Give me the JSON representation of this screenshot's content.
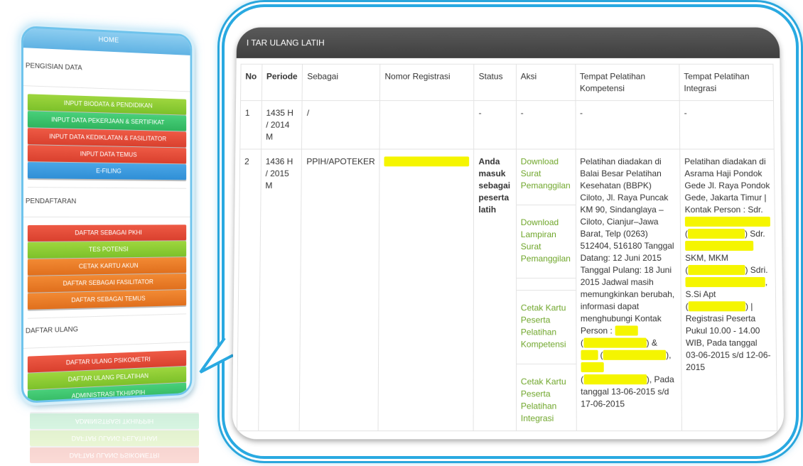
{
  "menu": {
    "home": "HOME",
    "sections": [
      {
        "title": "PENGISIAN DATA",
        "items": [
          {
            "label": "INPUT BIODATA & PENDIDIKAN",
            "color": "green"
          },
          {
            "label": "INPUT DATA PEKERJAAN & SERTIFIKAT",
            "color": "green2"
          },
          {
            "label": "INPUT DATA KEDIKLATAN & FASILITATOR",
            "color": "red"
          },
          {
            "label": "INPUT DATA TEMUS",
            "color": "red"
          },
          {
            "label": "E-FILING",
            "color": "blue"
          }
        ]
      },
      {
        "title": "PENDAFTARAN",
        "items": [
          {
            "label": "DAFTAR SEBAGAI PKHI",
            "color": "red"
          },
          {
            "label": "TES POTENSI",
            "color": "green"
          },
          {
            "label": "CETAK KARTU AKUN",
            "color": "orange"
          },
          {
            "label": "DAFTAR SEBAGAI FASILITATOR",
            "color": "orange"
          },
          {
            "label": "DAFTAR SEBAGAI TEMUS",
            "color": "orange"
          }
        ]
      },
      {
        "title": "DAFTAR ULANG",
        "items": [
          {
            "label": "DAFTAR ULANG PSIKOMETRI",
            "color": "red"
          },
          {
            "label": "DAFTAR ULANG PELATIHAN",
            "color": "green"
          },
          {
            "label": "ADMINISTRASI TKHI/PPIH",
            "color": "green2"
          }
        ]
      }
    ]
  },
  "colors": {
    "green": "#8ccd34",
    "green2": "#3cc36c",
    "red": "#e24a37",
    "blue": "#3c9ade",
    "orange": "#e97c27",
    "header_bg": "#4a4a4a",
    "link": "#6fa62a",
    "bubble_border": "#29a9e1"
  },
  "window": {
    "title": "I TAR ULANG LATIH"
  },
  "table": {
    "headers": {
      "no": "No",
      "periode": "Periode",
      "sebagai": "Sebagai",
      "reg": "Nomor Registrasi",
      "status": "Status",
      "aksi": "Aksi",
      "tk": "Tempat Pelatihan Kompetensi",
      "ti": "Tempat Pelatihan Integrasi"
    },
    "rows": [
      {
        "no": "1",
        "periode": "1435 H / 2014 M",
        "sebagai": "/",
        "reg": "",
        "status": "-",
        "aksi": "-",
        "tk": "-",
        "ti": "-"
      },
      {
        "no": "2",
        "periode": "1436 H / 2015 M",
        "sebagai": "PPIH/APOTEKER",
        "reg_redacted": true,
        "status": "Anda masuk sebagai peserta latih",
        "aksi": [
          "Download Surat Pemanggilan",
          "Download Lampiran Surat Pemanggilan",
          "Cetak Kartu Peserta Pelatihan Kompetensi",
          "Cetak Kartu Peserta Pelatihan Integrasi"
        ],
        "tk": {
          "part1": "Pelatihan diadakan di Balai Besar Pelatihan Kesehatan (BBPK) Ciloto, Jl. Raya Puncak KM 90, Sindanglaya – Ciloto, Cianjur–Jawa Barat, Telp (0263) 512404, 516180 Tanggal Datang: 12 Juni 2015 Tanggal Pulang: 18 Juni 2015 Jadwal masih memungkinkan berubah, informasi dapat menghubungi Kontak Person :",
          "part2": "&",
          "part3": "),",
          "part4": "), Pada tanggal 13-06-2015 s/d 17-06-2015"
        },
        "ti": {
          "part1": "Pelatihan diadakan di Asrama Haji Pondok Gede Jl. Raya Pondok Gede, Jakarta Timur | Kontak Person : Sdr.",
          "part2": ") Sdr.",
          "part3": "SKM, MKM",
          "part4": ") Sdri.",
          "part5": ",",
          "part6": "S.Si Apt",
          "part7": ") | Registrasi Peserta Pukul 10.00 - 14.00 WIB, Pada tanggal 03-06-2015 s/d 12-06-2015"
        }
      }
    ]
  }
}
